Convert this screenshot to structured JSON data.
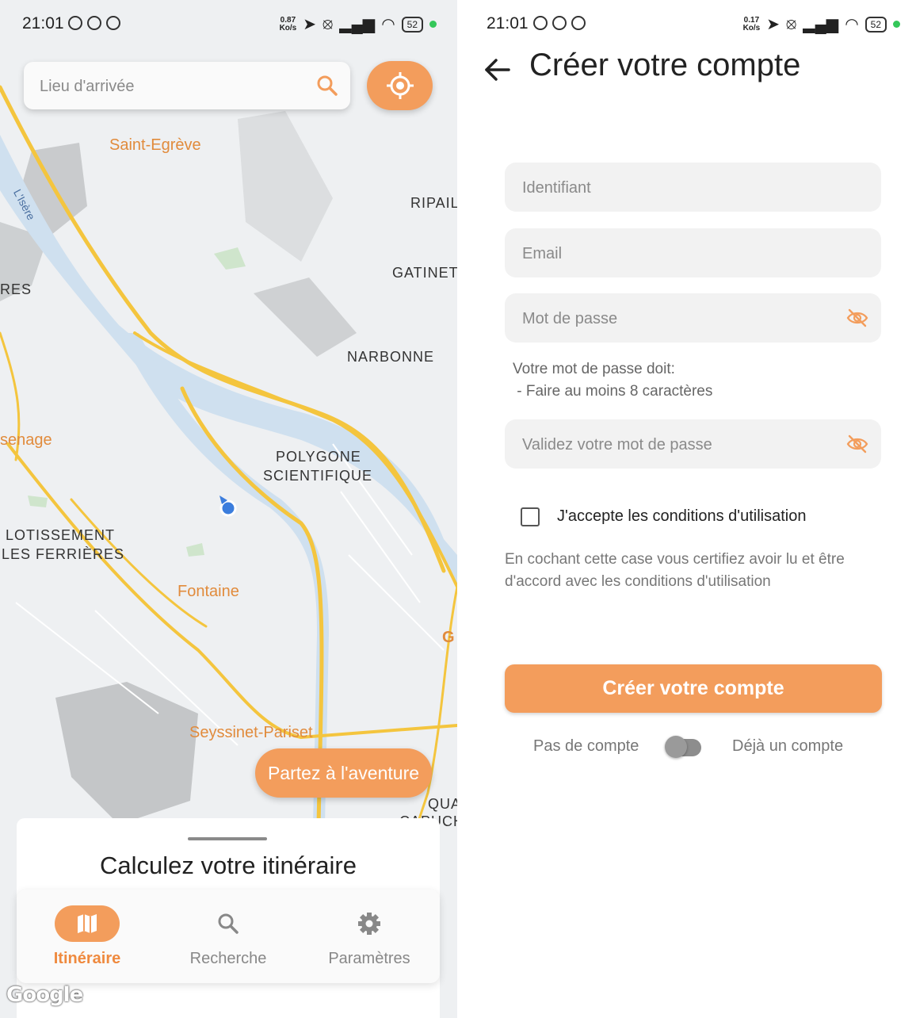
{
  "status_bar_left": {
    "time": "21:01",
    "speed": "0.87",
    "speed_unit": "Ko/s",
    "battery": "52"
  },
  "status_bar_right": {
    "time": "21:01",
    "speed": "0.17",
    "speed_unit": "Ko/s",
    "battery": "52"
  },
  "map_screen": {
    "search": {
      "placeholder": "Lieu d'arrivée"
    },
    "map_labels": {
      "saint_egreve": "Saint-Egrève",
      "ripail": "RIPAIL",
      "gatinet": "GATINET",
      "res": "RES",
      "narbonne": "NARBONNE",
      "isere": "L'Isère",
      "senage": "senage",
      "polygone_1": "POLYGONE",
      "polygone_2": "SCIENTIFIQUE",
      "lotissement_1": "LOTISSEMENT",
      "lotissement_2": "LES FERRIÈRES",
      "fontaine": "Fontaine",
      "seyssinet": "Seyssinet-Pariset",
      "g": "G",
      "qua": "QUA",
      "capuch": "CAPUCH"
    },
    "adventure_button": "Partez à l'aventure",
    "sheet_title": "Calculez votre itinéraire",
    "nav": {
      "itineraire": "Itinéraire",
      "recherche": "Recherche",
      "parametres": "Paramètres"
    },
    "google_logo": "Google",
    "colors": {
      "accent": "#f39d5c",
      "road": "#f4c53e",
      "river": "#cfe0ef",
      "location": "#3b7ddd"
    }
  },
  "register_screen": {
    "title": "Créer votre compte",
    "fields": {
      "identifiant": "Identifiant",
      "email": "Email",
      "password": "Mot de passe",
      "confirm_password": "Validez votre mot de passe"
    },
    "password_rules": "Votre mot de passe doit:\n - Faire au moins 8 caractères",
    "checkbox_label": "J'accepte les conditions d'utilisation",
    "checkbox_checked": false,
    "checkbox_note": "En cochant cette case vous certifiez avoir lu et être d'accord avec les conditions d'utilisation",
    "submit_button": "Créer votre compte",
    "toggle": {
      "left_label": "Pas de compte",
      "right_label": "Déjà un compte",
      "on": false
    }
  }
}
